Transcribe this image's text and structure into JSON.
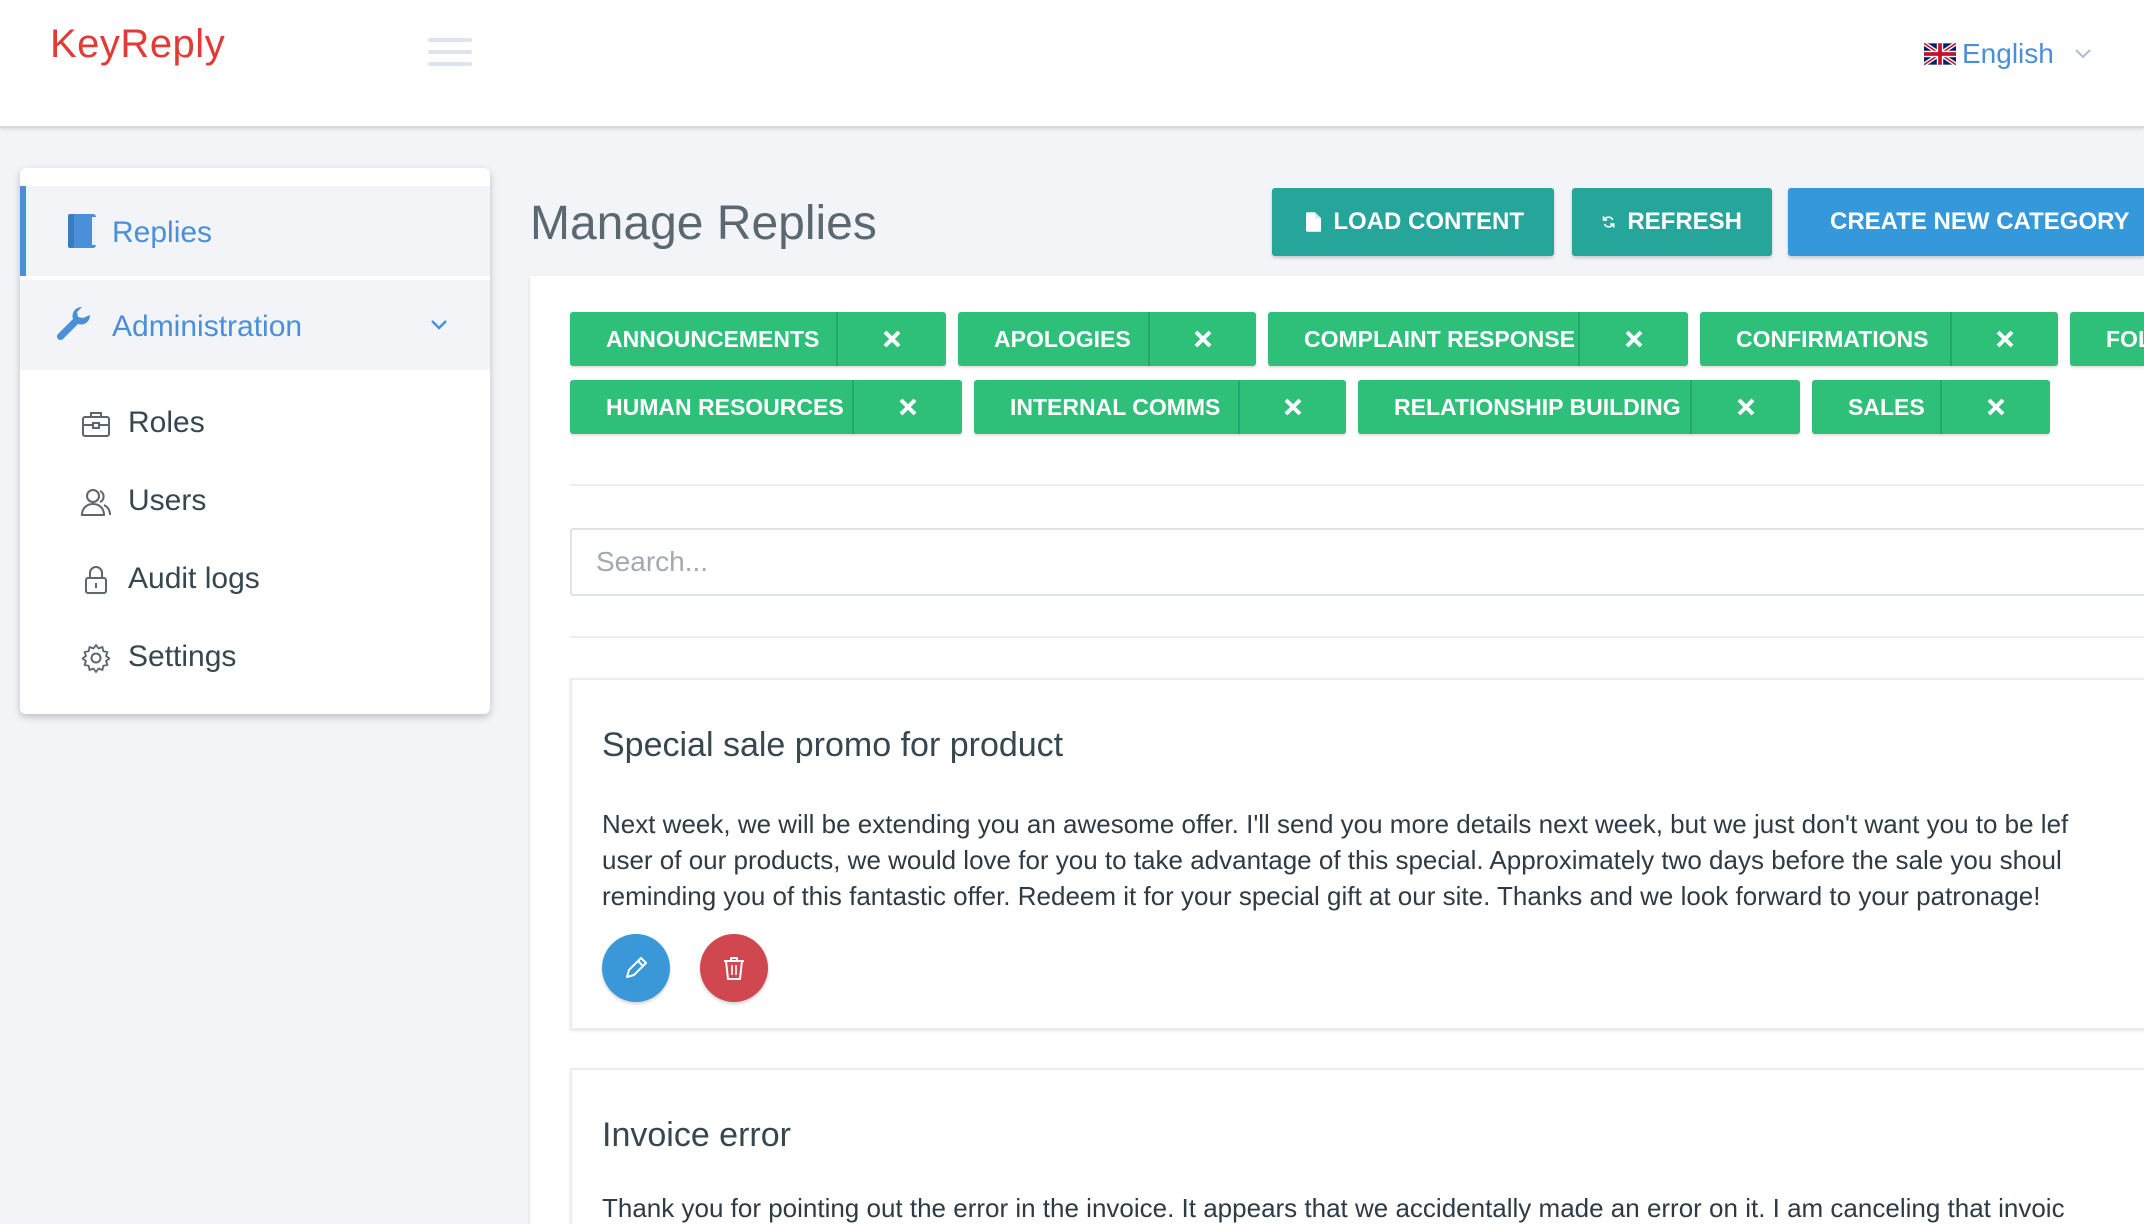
{
  "header": {
    "logo_text": "KeyReply",
    "language": "English"
  },
  "sidebar": {
    "main_items": [
      {
        "label": "Replies",
        "icon": "book-icon"
      },
      {
        "label": "Administration",
        "icon": "wrench-icon"
      }
    ],
    "admin_items": [
      {
        "label": "Roles",
        "icon": "briefcase-icon"
      },
      {
        "label": "Users",
        "icon": "users-icon"
      },
      {
        "label": "Audit logs",
        "icon": "lock-icon"
      },
      {
        "label": "Settings",
        "icon": "gear-icon"
      }
    ]
  },
  "main": {
    "title": "Manage Replies",
    "actions": {
      "load_content": "LOAD CONTENT",
      "refresh": "REFRESH",
      "create_category": "CREATE NEW CATEGORY"
    },
    "categories": [
      "ANNOUNCEMENTS",
      "APOLOGIES",
      "COMPLAINT RESPONSE",
      "CONFIRMATIONS",
      "FOL",
      "HUMAN RESOURCES",
      "INTERNAL COMMS",
      "RELATIONSHIP BUILDING",
      "SALES"
    ],
    "search_placeholder": "Search...",
    "replies": [
      {
        "title": "Special sale promo for product",
        "body_lines": [
          "Next week, we will be extending you an awesome offer. I'll send you more details next week, but we just don't want you to be lef",
          "user of our products, we would love for you to take advantage of this special. Approximately two days before the sale you shoul",
          "reminding you of this fantastic offer. Redeem it for your special gift at our site. Thanks and we look forward to your patronage!"
        ]
      },
      {
        "title": "Invoice error",
        "body_lines": [
          "Thank you for pointing out the error in the invoice. It appears that we accidentally made an error on it. I am canceling that invoic"
        ]
      }
    ]
  },
  "colors": {
    "brand_red": "#e53935",
    "link_blue": "#4a90d9",
    "teal": "#26a69a",
    "tag_green": "#2ebf79",
    "primary_blue": "#3498db",
    "danger_red": "#d0474f"
  }
}
